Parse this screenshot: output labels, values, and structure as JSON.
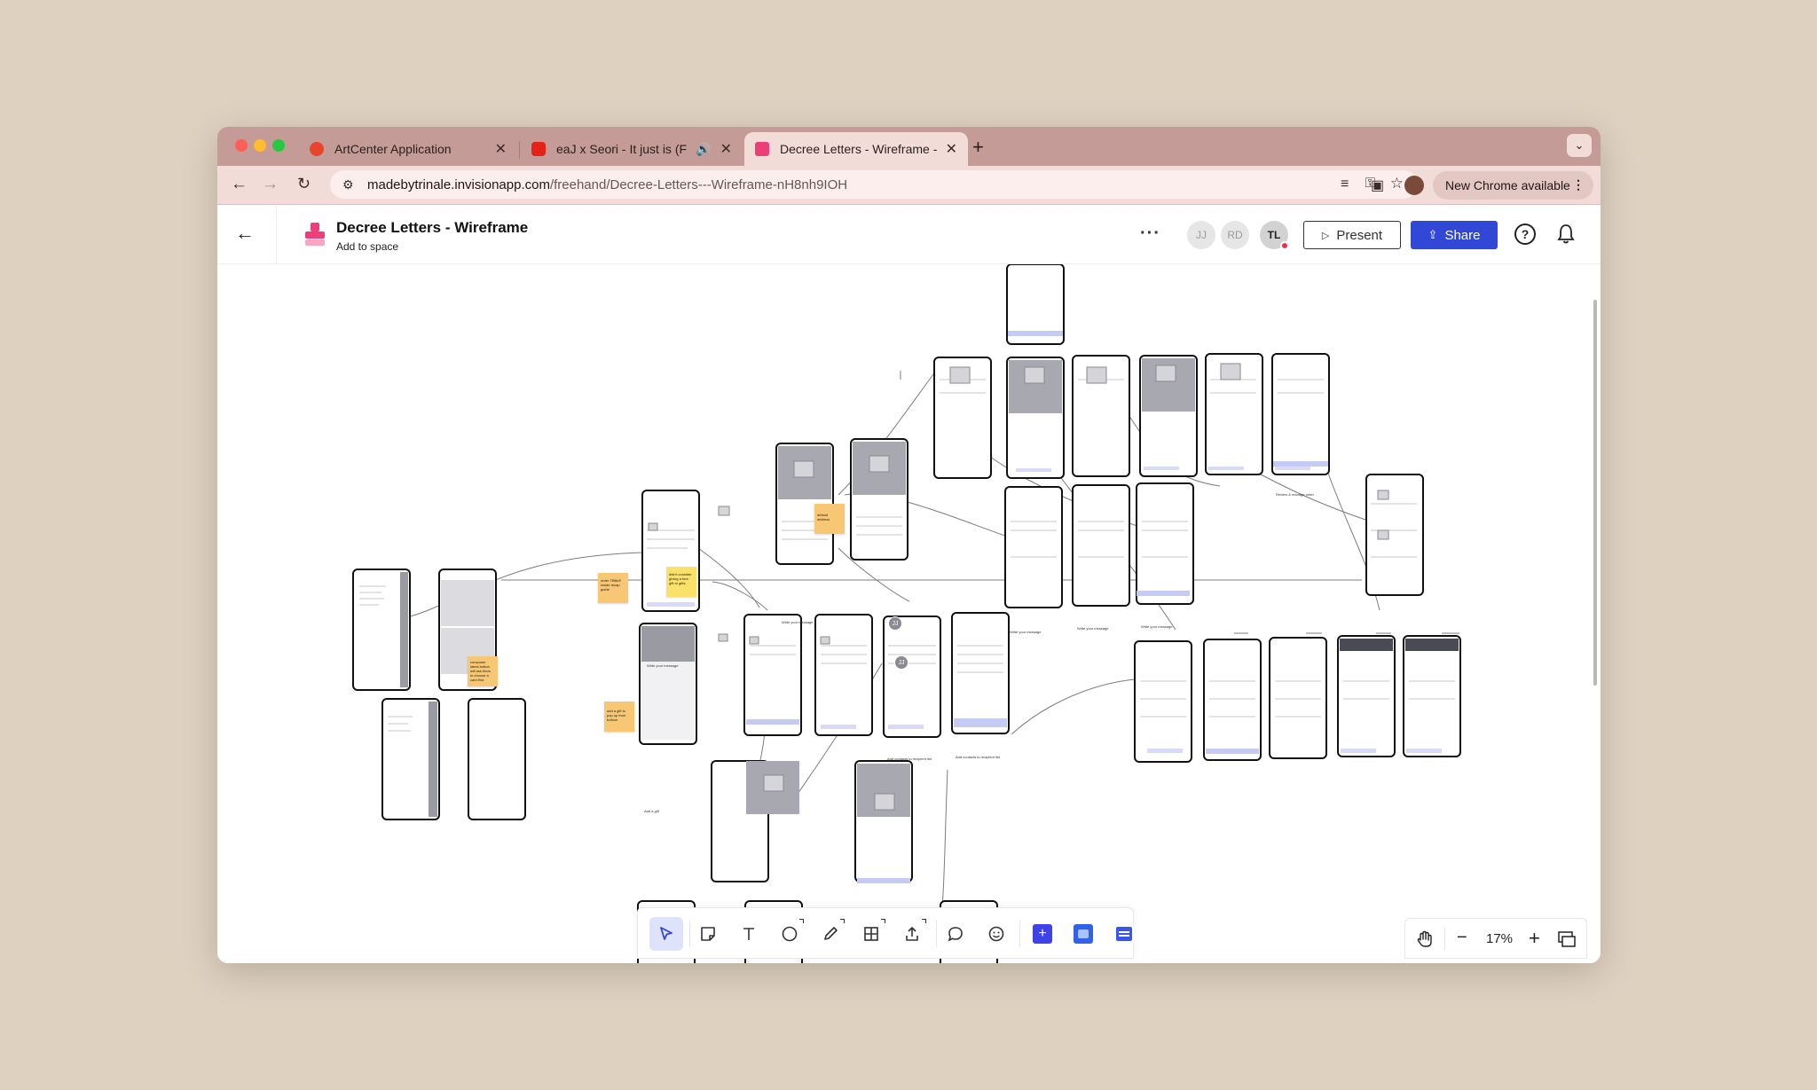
{
  "browser": {
    "tabs": [
      {
        "title": "ArtCenter Application",
        "favicon_color": "#e8452c"
      },
      {
        "title": "eaJ x Seori - It just is (Fea",
        "favicon_color": "#e62117"
      },
      {
        "title": "Decree Letters - Wireframe -",
        "favicon_color": "#ee3e7a"
      }
    ],
    "url_host": "madebytrinale.invisionapp.com",
    "url_path": "/freehand/Decree-Letters---Wireframe-nH8nh9IOH",
    "update_button": "New Chrome available"
  },
  "app": {
    "title": "Decree Letters - Wireframe",
    "subtitle": "Add to space",
    "avatars": [
      "JJ",
      "RD",
      "TL"
    ],
    "present_label": "Present",
    "share_label": "Share",
    "help_label": "?",
    "accent_color": "#3147d6"
  },
  "canvas": {
    "sticky_notes": [
      "default\naddress",
      "order TBBs®\ninside recap\nguide",
      "didn't consider\ngiving a font\ngift or gifts",
      "composer\nlatest button\nwill ask them\nto choose a\ncard first",
      "add a gift to\npop up from\nbottom"
    ],
    "screen_labels": [
      "Write your message",
      "Write your message",
      "Write your message",
      "Write your message",
      "Write your message",
      "Review & manage order",
      "Add a gift",
      "Add contacts",
      "Update contact",
      "Add contacts to recipient list",
      "Add contacts to recipient list"
    ],
    "cursor_badges": [
      "JJ",
      "JJ"
    ]
  },
  "toolbar": {
    "tools": [
      "select",
      "sticky-note",
      "text",
      "shape",
      "pen",
      "table",
      "upload",
      "comment",
      "sticker"
    ],
    "zoom": "17%"
  }
}
